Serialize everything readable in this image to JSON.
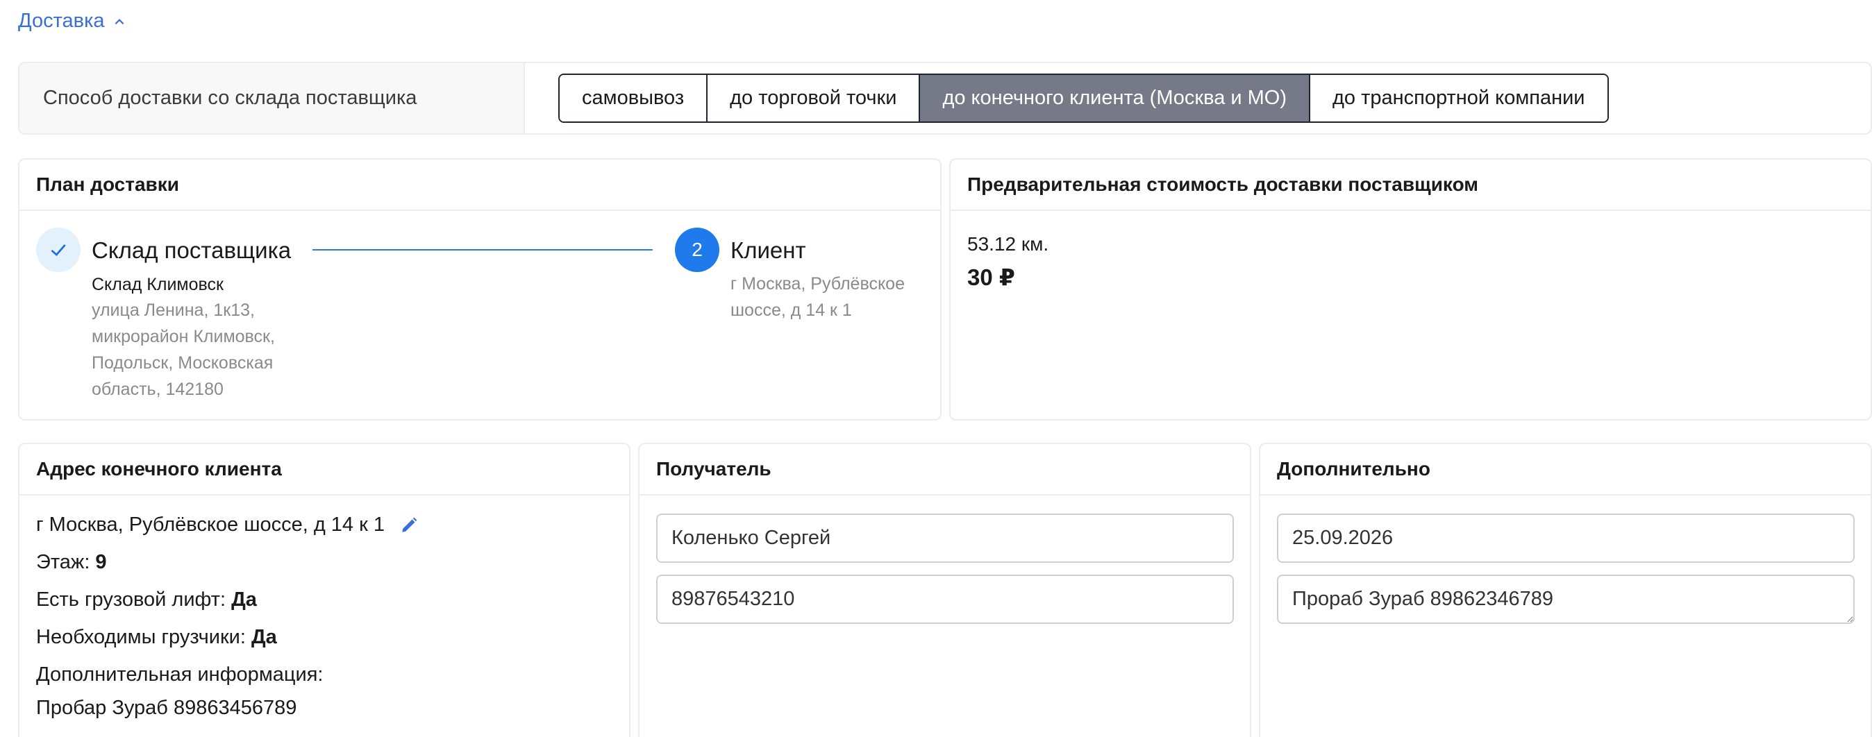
{
  "section": {
    "title": "Доставка",
    "expanded": true
  },
  "delivery_method": {
    "label": "Способ доставки со склада поставщика",
    "options": [
      "самовывоз",
      "до торговой точки",
      "до конечного клиента (Москва и МО)",
      "до транспортной компании"
    ],
    "selected": "до конечного клиента (Москва и МО)"
  },
  "plan": {
    "title": "План доставки",
    "from": {
      "title": "Склад поставщика",
      "name": "Склад Климовск",
      "address_lines": [
        "улица Ленина, 1к13,",
        "микрорайон Климовск,",
        "Подольск, Московская",
        "область, 142180"
      ],
      "status_icon": "check-icon"
    },
    "to": {
      "step_number": "2",
      "title": "Клиент",
      "address_lines": [
        "г Москва, Рублёвское",
        "шоссе, д 14 к 1"
      ]
    }
  },
  "cost": {
    "title": "Предварительная стоимость доставки поставщиком",
    "distance": "53.12 км.",
    "price": "30 ₽"
  },
  "client_address": {
    "title": "Адрес конечного клиента",
    "address": "г Москва, Рублёвское шоссе, д 14 к 1",
    "floor_label": "Этаж:",
    "floor_value": "9",
    "lift_label": "Есть грузовой лифт:",
    "lift_value": "Да",
    "movers_label": "Необходимы грузчики:",
    "movers_value": "Да",
    "extra_label": "Дополнительная информация:",
    "extra_value": "Пробар Зураб 89863456789"
  },
  "recipient": {
    "title": "Получатель",
    "name": "Коленько Сергей",
    "phone": "89876543210"
  },
  "additional": {
    "title": "Дополнительно",
    "date": "25.09.2026",
    "comment": "Прораб Зураб 89862346789"
  },
  "colors": {
    "accent": "#1f7aeb",
    "link": "#3b6fd8",
    "active_button": "#767a88"
  }
}
